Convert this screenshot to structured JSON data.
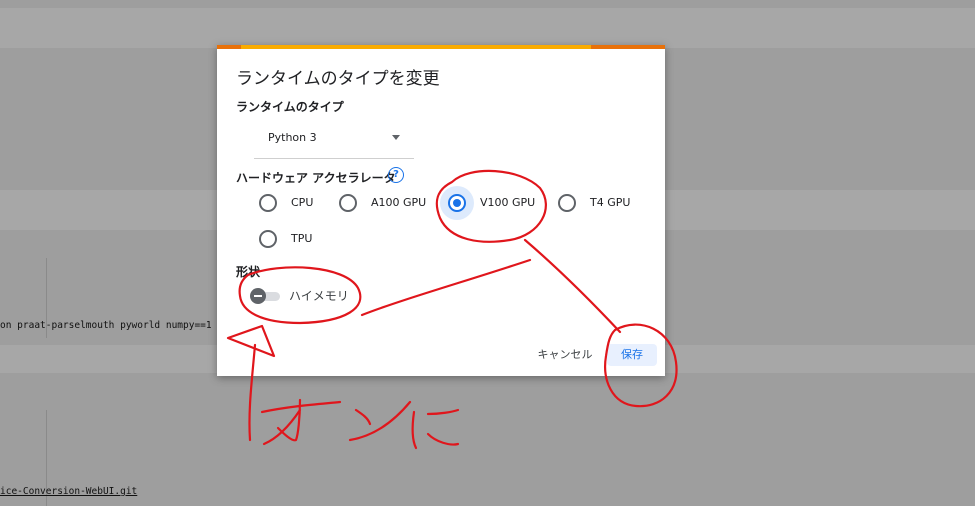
{
  "background": {
    "code_line_1": "on praat-parselmouth pyworld numpy==1",
    "code_line_2": "ice-Conversion-WebUI.git"
  },
  "dialog": {
    "title": "ランタイムのタイプを変更",
    "runtime_type_label": "ランタイムのタイプ",
    "runtime_type_value": "Python 3",
    "accelerator_label": "ハードウェア アクセラレータ",
    "help_icon_glyph": "?",
    "accelerators": [
      {
        "label": "CPU",
        "checked": false
      },
      {
        "label": "A100 GPU",
        "checked": false
      },
      {
        "label": "V100 GPU",
        "checked": true
      },
      {
        "label": "T4 GPU",
        "checked": false
      },
      {
        "label": "TPU",
        "checked": false
      }
    ],
    "shape_label": "形状",
    "high_ram_label": "ハイメモリ",
    "high_ram_on": false,
    "cancel_label": "キャンセル",
    "save_label": "保存",
    "accent_color": "#1a73e8",
    "progress_colors": [
      "#e8710a",
      "#f9ab00"
    ]
  },
  "annotation": {
    "handwritten_text": "オンに",
    "ink_color": "#e0161c"
  }
}
